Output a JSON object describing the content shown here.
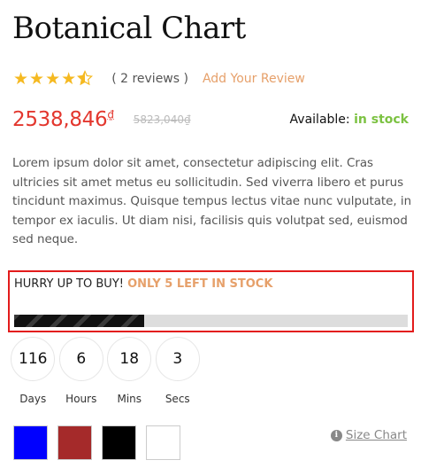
{
  "product": {
    "title": "Botanical Chart",
    "rating_value": 4.5,
    "rating_max": 5,
    "reviews_text": "( 2 reviews )",
    "add_review": "Add Your Review",
    "price": "2538,846",
    "currency": "₫",
    "old_price": "5823,040₫",
    "availability_label": "Available:",
    "availability_status": "in stock",
    "description": "Lorem ipsum dolor sit amet, consectetur adipiscing elit. Cras ultricies sit amet metus eu sollicitudin. Sed viverra libero et purus tincidunt maximus. Quisque tempus lectus vitae nunc vulputate, in tempor ex iaculis. Ut diam nisi, facilisis quis volutpat sed, euismod sed neque."
  },
  "stock_alert": {
    "prefix": "HURRY UP TO BUY!",
    "highlight": "ONLY 5 LEFT IN STOCK",
    "progress_fraction": 0.33
  },
  "countdown": [
    {
      "value": "116",
      "label": "Days"
    },
    {
      "value": "6",
      "label": "Hours"
    },
    {
      "value": "18",
      "label": "Mins"
    },
    {
      "value": "3",
      "label": "Secs"
    }
  ],
  "swatches": [
    {
      "name": "blue",
      "color": "#0000ff"
    },
    {
      "name": "red",
      "color": "#a52a2a"
    },
    {
      "name": "black",
      "color": "#000000"
    },
    {
      "name": "white",
      "color": "#ffffff"
    }
  ],
  "size_chart": {
    "icon": "info-icon",
    "label": "Size Chart"
  },
  "colors": {
    "accent": "#e6a06a",
    "price": "#e3372e",
    "in_stock": "#7cc242",
    "star": "#f5b921",
    "highlight_border": "#e31b1b"
  }
}
